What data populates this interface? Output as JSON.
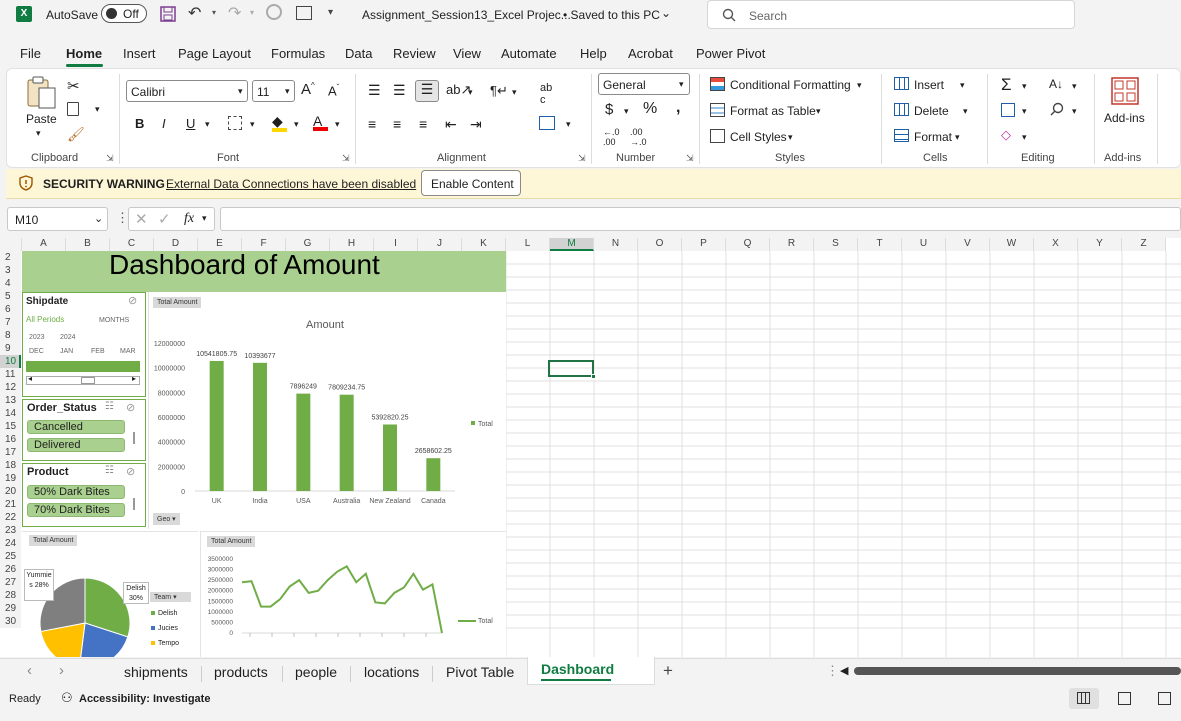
{
  "titlebar": {
    "autosave_label": "AutoSave",
    "autosave_state": "Off",
    "filename": "Assignment_Session13_Excel Projec...",
    "save_status": "• Saved to this PC",
    "search_placeholder": "Search"
  },
  "menu": [
    "File",
    "Home",
    "Insert",
    "Page Layout",
    "Formulas",
    "Data",
    "Review",
    "View",
    "Automate",
    "Help",
    "Acrobat",
    "Power Pivot"
  ],
  "ribbon": {
    "paste": "Paste",
    "font_name": "Calibri",
    "font_size": "11",
    "number_format": "General",
    "conditional_formatting": "Conditional Formatting",
    "format_as_table": "Format as Table",
    "cell_styles": "Cell Styles",
    "insert": "Insert",
    "delete": "Delete",
    "format": "Format",
    "addins": "Add-ins",
    "groups": {
      "clipboard": "Clipboard",
      "font": "Font",
      "alignment": "Alignment",
      "number": "Number",
      "styles": "Styles",
      "cells": "Cells",
      "editing": "Editing",
      "addins": "Add-ins"
    }
  },
  "security": {
    "label": "SECURITY WARNING",
    "message": "External Data Connections have been disabled",
    "button": "Enable Content"
  },
  "formula_bar": {
    "name_box": "M10",
    "fx": "fx"
  },
  "columns": [
    "A",
    "B",
    "C",
    "D",
    "E",
    "F",
    "G",
    "H",
    "I",
    "J",
    "K",
    "L",
    "M",
    "N",
    "O",
    "P",
    "Q",
    "R",
    "S",
    "T",
    "U",
    "V",
    "W",
    "X",
    "Y",
    "Z"
  ],
  "rows": [
    "2",
    "3",
    "4",
    "5",
    "6",
    "7",
    "8",
    "9",
    "10",
    "11",
    "12",
    "13",
    "14",
    "15",
    "16",
    "17",
    "18",
    "19",
    "20",
    "21",
    "22",
    "23",
    "24",
    "25",
    "26",
    "27",
    "28",
    "29",
    "30"
  ],
  "dashboard": {
    "title": "Dashboard of Amount",
    "shipdate_slicer": {
      "title": "Shipdate",
      "all_periods": "All Periods",
      "months": "MONTHS",
      "year1": "2023",
      "year2": "2024",
      "m1": "DEC",
      "m2": "JAN",
      "m3": "FEB",
      "m4": "MAR"
    },
    "order_status_slicer": {
      "title": "Order_Status",
      "items": [
        "Cancelled",
        "Delivered"
      ]
    },
    "product_slicer": {
      "title": "Product",
      "items": [
        "50% Dark Bites",
        "70% Dark Bites"
      ]
    },
    "pivot_field_button": "Total Amount",
    "geo_button": "Geo",
    "team_button": "Team",
    "pie_labels": {
      "yummies": "Yummie s 28%",
      "delish": "Delish 30%"
    },
    "pie_legend": [
      "Delish",
      "Jucies",
      "Tempo"
    ]
  },
  "chart_data": [
    {
      "type": "bar",
      "title": "Amount",
      "categories": [
        "UK",
        "India",
        "USA",
        "Australia",
        "New Zealand",
        "Canada"
      ],
      "series": [
        {
          "name": "Total",
          "values": [
            10541805.75,
            10393677,
            7896249,
            7809234.75,
            5392820.25,
            2658602.25
          ]
        }
      ],
      "data_labels": [
        "10541805.75",
        "10393677",
        "7896249",
        "7809234.75",
        "5392820.25",
        "2658602.25"
      ],
      "ylim": [
        0,
        12000000
      ],
      "yticks": [
        "12000000",
        "10000000",
        "8000000",
        "6000000",
        "4000000",
        "2000000",
        "0"
      ],
      "legend": "right",
      "color": "#70ad47"
    },
    {
      "type": "pie",
      "slices": [
        {
          "name": "Delish",
          "value": 30,
          "color": "#70ad47"
        },
        {
          "name": "Jucies",
          "value": 22,
          "color": "#4472c4"
        },
        {
          "name": "Tempo",
          "value": 20,
          "color": "#ffc000"
        },
        {
          "name": "Yummies",
          "value": 28,
          "color": "#7f7f7f"
        }
      ]
    },
    {
      "type": "line",
      "series": [
        {
          "name": "Total",
          "values": [
            2400000,
            2450000,
            1250000,
            1250000,
            1600000,
            2200000,
            2500000,
            1900000,
            2000000,
            2500000,
            2900000,
            3150000,
            2400000,
            2800000,
            1450000,
            1400000,
            1900000,
            2150000,
            2800000,
            2050000,
            2300000,
            0
          ]
        }
      ],
      "ylim": [
        0,
        3500000
      ],
      "yticks": [
        "3500000",
        "3000000",
        "2500000",
        "2000000",
        "1500000",
        "1000000",
        "500000",
        "0"
      ],
      "legend": "right",
      "color": "#70ad47"
    }
  ],
  "sheets": [
    "shipments",
    "products",
    "people",
    "locations",
    "Pivot Table",
    "Dashboard"
  ],
  "active_sheet": "Dashboard",
  "status": {
    "ready": "Ready",
    "accessibility": "Accessibility: Investigate"
  },
  "colors": {
    "excel_green": "#107c41",
    "dashboard_header": "#a9d08e",
    "bar_green": "#70ad47",
    "selection": "#217346",
    "warning_bar": "#fdf6d7"
  }
}
